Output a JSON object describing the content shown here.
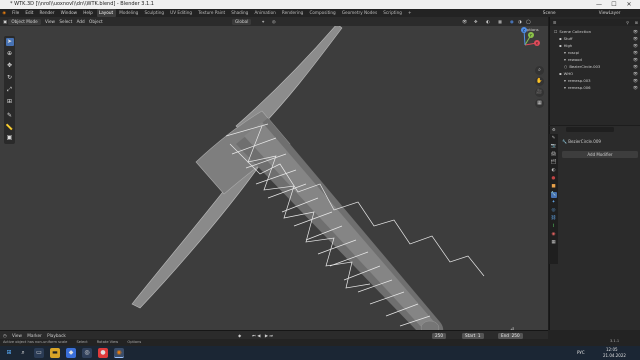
{
  "window": {
    "title": "* WTK.3D [\\\\nrol\\\\uoxnovl\\\\dn\\\\WTK.blend] - Blender 3.1.1",
    "minimize": "—",
    "maximize": "☐",
    "close": "✕"
  },
  "menu": {
    "items": [
      "File",
      "Edit",
      "Render",
      "Window",
      "Help"
    ],
    "workspaces": [
      "Layout",
      "Modeling",
      "Sculpting",
      "UV Editing",
      "Texture Paint",
      "Shading",
      "Animation",
      "Rendering",
      "Compositing",
      "Geometry Nodes",
      "Scripting",
      "+"
    ],
    "active_workspace": "Layout",
    "scene_label": "Scene",
    "view_layer_label": "ViewLayer"
  },
  "viewport_header": {
    "mode": "Object Mode",
    "menus": [
      "View",
      "Select",
      "Add",
      "Object"
    ],
    "orientation": "Global",
    "options": "Options"
  },
  "gizmo": {
    "x": "X",
    "y": "Y",
    "z": "Z"
  },
  "outliner": {
    "title": "Scene Collection",
    "rows": [
      {
        "label": "Scene Collection",
        "indent": 0,
        "icon": "☐"
      },
      {
        "label": "Stuff",
        "indent": 1,
        "icon": "▪"
      },
      {
        "label": "High",
        "indent": 1,
        "icon": "▪"
      },
      {
        "label": "roscpi",
        "indent": 2,
        "icon": "▾"
      },
      {
        "label": "rewood",
        "indent": 2,
        "icon": "▾"
      },
      {
        "label": "BezierCircle.003",
        "indent": 2,
        "icon": "○"
      },
      {
        "label": "WHO",
        "indent": 1,
        "icon": "▪"
      },
      {
        "label": "remesp.003",
        "indent": 2,
        "icon": "▾"
      },
      {
        "label": "remesp.006",
        "indent": 2,
        "icon": "▾"
      }
    ]
  },
  "properties": {
    "object_name": "BezierCircle.009",
    "add_modifier": "Add Modifier"
  },
  "timeline": {
    "menus": [
      "View",
      "Marker",
      "Playback"
    ],
    "current_frame": "250",
    "start_label": "Start",
    "start": "1",
    "end_label": "End",
    "end": "250"
  },
  "statusbar": {
    "items": [
      "Active object has non-uniform scale",
      "Select",
      "Rotate View",
      "Options"
    ],
    "version": "3.1.1"
  },
  "taskbar": {
    "search_icon": "⌕",
    "lang": "РУС",
    "time": "12:05",
    "date": "21.04.2022"
  },
  "colors": {
    "accent": "#4772b3",
    "viewport": "#3d3d3d",
    "wire": "#e8e8e8"
  }
}
